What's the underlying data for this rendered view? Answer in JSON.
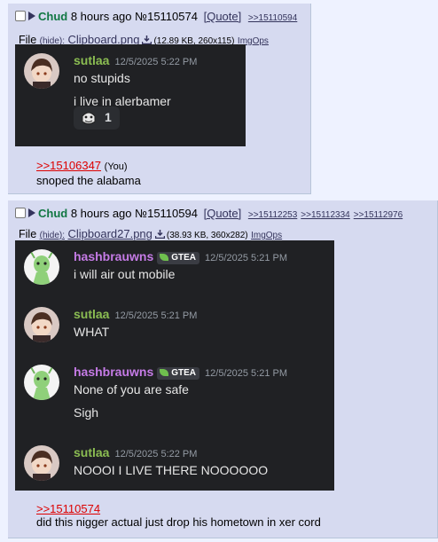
{
  "posts": [
    {
      "name": "Chud",
      "time": "8 hours ago",
      "number": "№15110574",
      "quote_label": "[Quote]",
      "backlinks": [
        ">>15110594"
      ],
      "file": {
        "label": "File",
        "hide": "(hide):",
        "filename": "Clipboard.png",
        "meta": "(12.89 KB, 260x115)",
        "imgops": "ImgOps"
      },
      "discord": {
        "messages": [
          {
            "user": "sutlaa",
            "time": "12/5/2025 5:22 PM",
            "lines": [
              "no stupids",
              "i live in alerbamer"
            ]
          }
        ],
        "reaction_count": "1"
      },
      "reply_link": ">>15106347",
      "reply_you": "(You)",
      "comment": "snoped the alabama"
    },
    {
      "name": "Chud",
      "time": "8 hours ago",
      "number": "№15110594",
      "quote_label": "[Quote]",
      "backlinks": [
        ">>15112253",
        ">>15112334",
        ">>15112976"
      ],
      "file": {
        "label": "File",
        "hide": "(hide):",
        "filename": "Clipboard27.png",
        "meta": "(38.93 KB, 360x282)",
        "imgops": "ImgOps"
      },
      "discord": {
        "messages": [
          {
            "user": "hashbrauwns",
            "tag": "GTEA",
            "time": "12/5/2025 5:21 PM",
            "lines": [
              "i will air out mobile"
            ]
          },
          {
            "user": "sutlaa",
            "time": "12/5/2025 5:21 PM",
            "lines": [
              "WHAT"
            ]
          },
          {
            "user": "hashbrauwns",
            "tag": "GTEA",
            "time": "12/5/2025 5:21 PM",
            "lines": [
              "None of you are safe",
              "Sigh"
            ]
          },
          {
            "user": "sutlaa",
            "time": "12/5/2025 5:22 PM",
            "lines": [
              "NOOOI I LIVE THERE NOOOOOO"
            ]
          }
        ]
      },
      "reply_link": ">>15110574",
      "comment": "did this nigger actual just drop his hometown in xer cord"
    }
  ],
  "colors": {
    "name_green": "#117743",
    "link": "#34345c",
    "quotelink": "#dd0000",
    "post_bg": "#d6daf0",
    "discord_bg": "#202124",
    "green_user": "#8bbd52",
    "purple_user": "#c57be6"
  },
  "icons": [
    "checkbox-icon",
    "post-menu-arrow-icon",
    "download-icon",
    "avatar-brunette",
    "avatar-green-alien",
    "clown-emoji-icon",
    "leaf-icon"
  ]
}
